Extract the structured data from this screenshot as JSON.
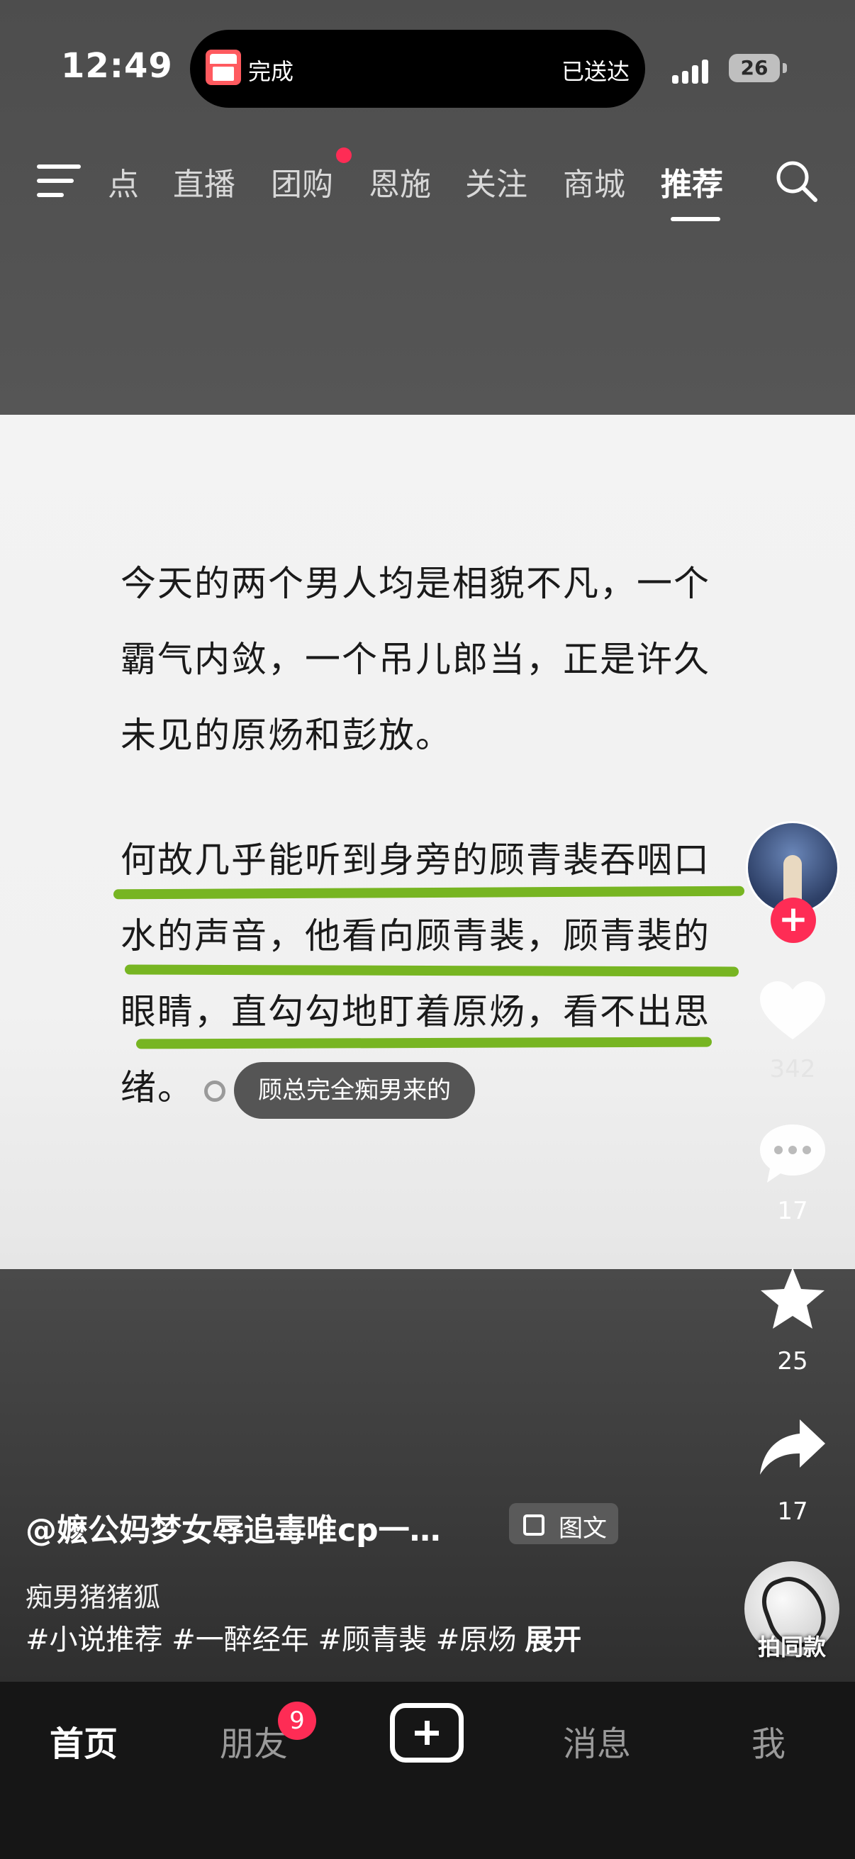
{
  "status_bar": {
    "time": "12:49",
    "island_left_text": "完成",
    "island_right_text": "已送达",
    "battery": "26"
  },
  "top_nav": {
    "tabs": [
      "点",
      "直播",
      "团购",
      "恩施",
      "关注",
      "商城",
      "推荐"
    ],
    "active_tab": "推荐",
    "has_dot_on": "团购"
  },
  "post": {
    "paragraph1": "今天的两个男人均是相貌不凡，一个霸气内敛，一个吊儿郎当，正是许久未见的原炀和彭放。",
    "paragraph1_lines": [
      "今天的两个男人均是相貌不凡，一个",
      "霸气内敛，一个吊儿郎当，正是许久",
      "未见的原炀和彭放。"
    ],
    "paragraph2_lines": [
      "何故几乎能听到身旁的顾青裴吞咽口",
      "水的声音，他看向顾青裴，顾青裴的",
      "眼睛，直勾勾地盯着原炀，看不出思",
      "绪。"
    ],
    "highlight_color": "#77b522",
    "comment_bubble": "顾总完全痴男来的"
  },
  "side_actions": {
    "like_count": "342",
    "comment_count": "17",
    "favorite_count": "25",
    "share_count": "17",
    "same_style_label": "拍同款"
  },
  "info": {
    "author": "@嬷公妈梦女辱追毒唯cp一…",
    "type_tag": "图文",
    "description": "痴男猪猪狐",
    "hashtags": "#小说推荐 #一醉经年 #顾青裴 #原炀",
    "expand": "展开"
  },
  "tab_bar": {
    "home": "首页",
    "friends": "朋友",
    "friends_badge": "9",
    "messages": "消息",
    "me": "我"
  },
  "colors": {
    "accent": "#fe2c55",
    "tabbar_bg": "#161616"
  }
}
